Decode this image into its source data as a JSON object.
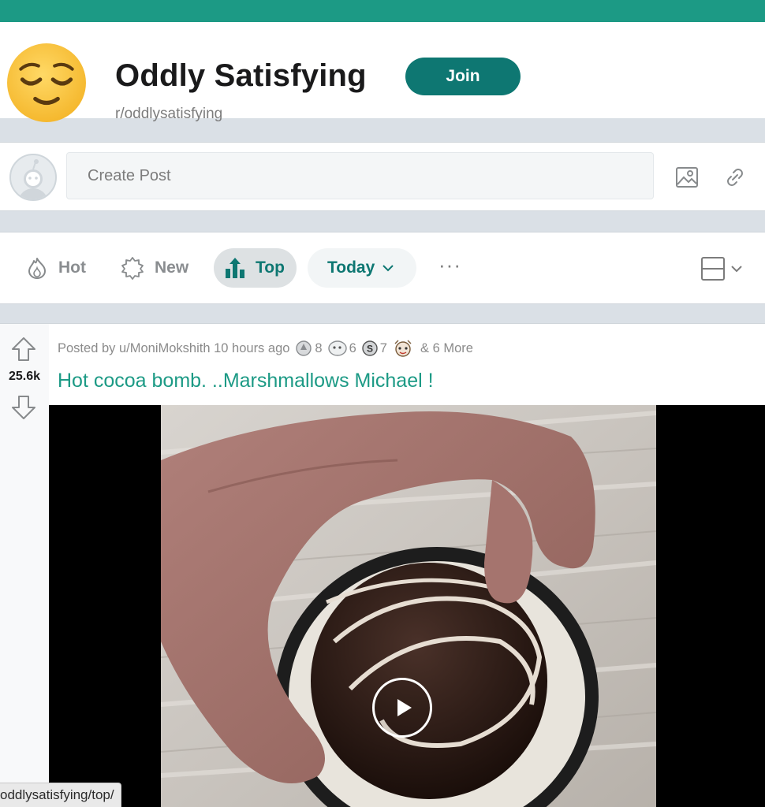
{
  "subreddit": {
    "title": "Oddly Satisfying",
    "name": "r/oddlysatisfying",
    "join_label": "Join",
    "icon": "relieved-face-emoji",
    "accent": "#1c9a85",
    "button_color": "#0e7772"
  },
  "create_post": {
    "placeholder": "Create Post",
    "image_icon": "image-icon",
    "link_icon": "link-icon"
  },
  "sort": {
    "items": [
      {
        "label": "Hot",
        "icon": "flame-icon"
      },
      {
        "label": "New",
        "icon": "sparkle-badge-icon"
      },
      {
        "label": "Top",
        "icon": "bar-chart-icon",
        "active": true
      }
    ],
    "time_filter": "Today",
    "more_label": "···",
    "layout_icon": "card-view-icon"
  },
  "post": {
    "votes": "25.6k",
    "posted_by": "Posted by u/MoniMokshith 10 hours ago",
    "awards": [
      {
        "icon": "silver-award-icon",
        "count": "8"
      },
      {
        "icon": "helpful-award-icon",
        "count": "6"
      },
      {
        "icon": "coin-award-icon",
        "count": "7"
      },
      {
        "icon": "wholesome-award-icon",
        "count": ""
      }
    ],
    "more_awards": "& 6 More",
    "title": "Hot cocoa bomb. ..Marshmallows Michael !",
    "media_type": "video"
  },
  "status_bar": {
    "url": "oddlysatisfying/top/"
  }
}
